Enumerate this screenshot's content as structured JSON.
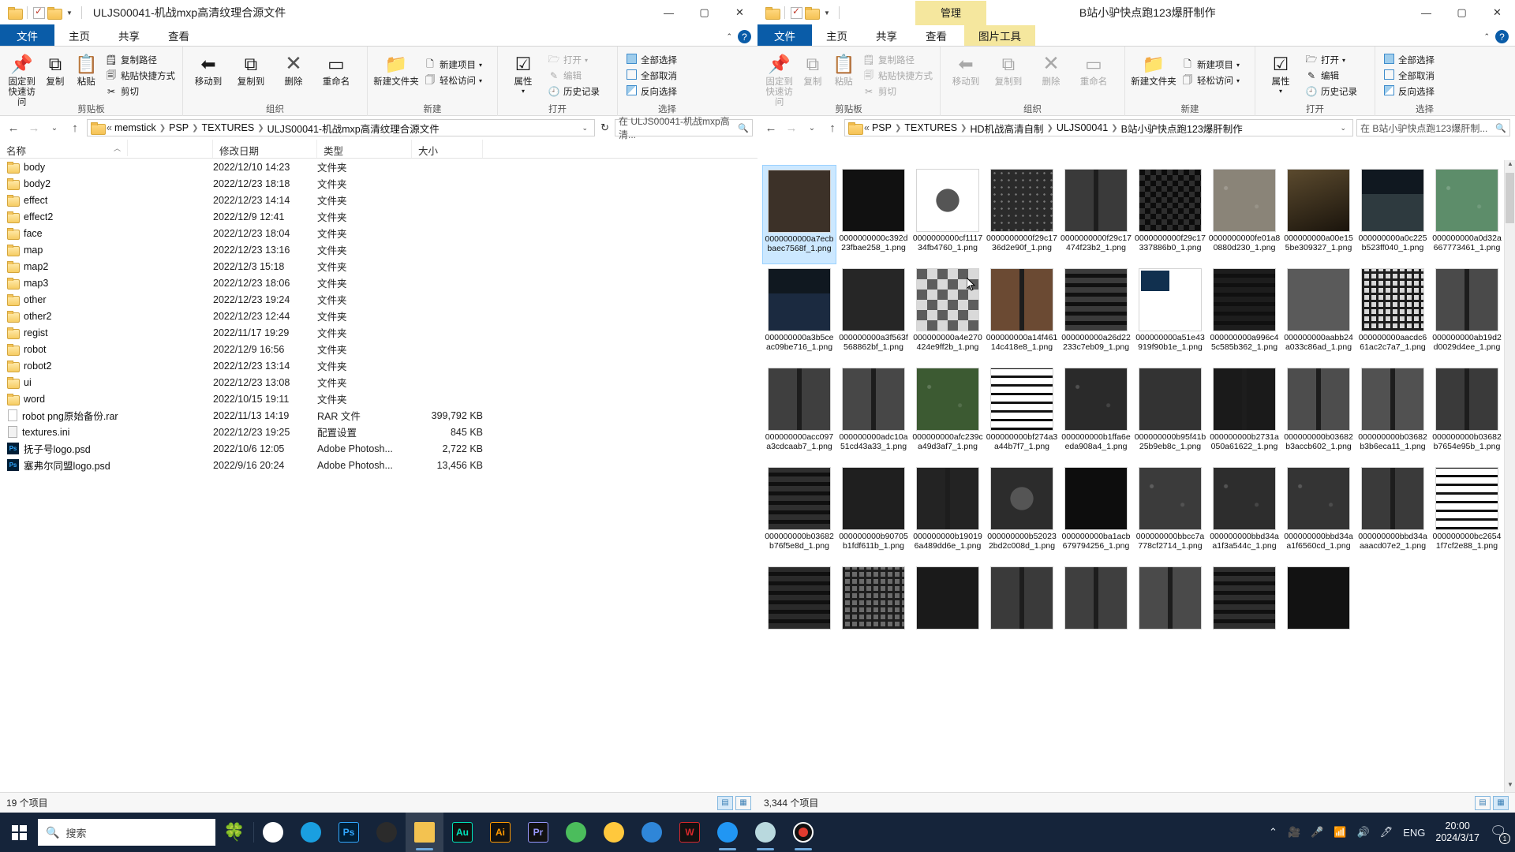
{
  "windows": {
    "left": {
      "title": "ULJS00041-机战mxp高清纹理合源文件",
      "quick_access": {
        "prop_icon": "checklist-icon",
        "folder_icon": "folder-icon",
        "caret": "▾"
      },
      "controls": {
        "minimize": "—",
        "maximize": "▢",
        "close": "✕"
      },
      "tabs": [
        {
          "label": "文件",
          "name": "tab-file"
        },
        {
          "label": "主页",
          "name": "tab-home"
        },
        {
          "label": "共享",
          "name": "tab-share"
        },
        {
          "label": "查看",
          "name": "tab-view"
        }
      ],
      "help_label": "?",
      "ribbon": {
        "groups": [
          {
            "name": "剪贴板",
            "big": [
              {
                "label": "固定到快速访问",
                "icon": "pin-icon"
              },
              {
                "label": "复制",
                "icon": "copy-icon"
              },
              {
                "label": "粘贴",
                "icon": "paste-icon"
              }
            ],
            "small": [
              {
                "label": "复制路径",
                "icon": "copy-path-icon",
                "disabled": false
              },
              {
                "label": "粘贴快捷方式",
                "icon": "paste-shortcut-icon",
                "disabled": false
              },
              {
                "label": "剪切",
                "icon": "scissors-icon",
                "disabled": false
              }
            ]
          },
          {
            "name": "组织",
            "big": [
              {
                "label": "移动到",
                "icon": "move-to-icon"
              },
              {
                "label": "复制到",
                "icon": "copy-to-icon"
              },
              {
                "label": "删除",
                "icon": "delete-x-icon"
              },
              {
                "label": "重命名",
                "icon": "rename-icon"
              }
            ],
            "small": []
          },
          {
            "name": "新建",
            "big": [
              {
                "label": "新建文件夹",
                "icon": "new-folder-icon"
              }
            ],
            "small": [
              {
                "label": "新建项目",
                "icon": "new-item-icon"
              },
              {
                "label": "轻松访问",
                "icon": "easy-access-icon"
              }
            ]
          },
          {
            "name": "打开",
            "big": [
              {
                "label": "属性",
                "icon": "properties-icon"
              }
            ],
            "small": [
              {
                "label": "打开",
                "icon": "open-icon",
                "disabled": true
              },
              {
                "label": "编辑",
                "icon": "edit-icon",
                "disabled": true
              },
              {
                "label": "历史记录",
                "icon": "history-icon",
                "disabled": false
              }
            ]
          },
          {
            "name": "选择",
            "big": [],
            "small": [
              {
                "label": "全部选择",
                "icon": "select-all-icon"
              },
              {
                "label": "全部取消",
                "icon": "select-none-icon"
              },
              {
                "label": "反向选择",
                "icon": "invert-selection-icon"
              }
            ]
          }
        ]
      },
      "address": {
        "back": "←",
        "forward": "→",
        "recent": "⌄",
        "up": "↑",
        "crumbs": [
          "memstick",
          "PSP",
          "TEXTURES",
          "ULJS00041-机战mxp高清纹理合源文件"
        ],
        "prefix": "«",
        "dropdown": "⌄",
        "refresh": "↻",
        "search_value": "在 ULJS00041-机战mxp高清...",
        "search_icon": "search-icon"
      },
      "columns": [
        {
          "label": "名称",
          "name": "column-name"
        },
        {
          "label": "修改日期",
          "name": "column-date"
        },
        {
          "label": "类型",
          "name": "column-type"
        },
        {
          "label": "大小",
          "name": "column-size"
        }
      ],
      "rows": [
        {
          "name": "body",
          "date": "2022/12/10 14:23",
          "type": "文件夹",
          "size": "",
          "icon": "folder"
        },
        {
          "name": "body2",
          "date": "2022/12/23 18:18",
          "type": "文件夹",
          "size": "",
          "icon": "folder"
        },
        {
          "name": "effect",
          "date": "2022/12/23 14:14",
          "type": "文件夹",
          "size": "",
          "icon": "folder"
        },
        {
          "name": "effect2",
          "date": "2022/12/9 12:41",
          "type": "文件夹",
          "size": "",
          "icon": "folder"
        },
        {
          "name": "face",
          "date": "2022/12/23 18:04",
          "type": "文件夹",
          "size": "",
          "icon": "folder"
        },
        {
          "name": "map",
          "date": "2022/12/23 13:16",
          "type": "文件夹",
          "size": "",
          "icon": "folder"
        },
        {
          "name": "map2",
          "date": "2022/12/3 15:18",
          "type": "文件夹",
          "size": "",
          "icon": "folder"
        },
        {
          "name": "map3",
          "date": "2022/12/23 18:06",
          "type": "文件夹",
          "size": "",
          "icon": "folder"
        },
        {
          "name": "other",
          "date": "2022/12/23 19:24",
          "type": "文件夹",
          "size": "",
          "icon": "folder"
        },
        {
          "name": "other2",
          "date": "2022/12/23 12:44",
          "type": "文件夹",
          "size": "",
          "icon": "folder"
        },
        {
          "name": "regist",
          "date": "2022/11/17 19:29",
          "type": "文件夹",
          "size": "",
          "icon": "folder"
        },
        {
          "name": "robot",
          "date": "2022/12/9 16:56",
          "type": "文件夹",
          "size": "",
          "icon": "folder"
        },
        {
          "name": "robot2",
          "date": "2022/12/23 13:14",
          "type": "文件夹",
          "size": "",
          "icon": "folder"
        },
        {
          "name": "ui",
          "date": "2022/12/23 13:08",
          "type": "文件夹",
          "size": "",
          "icon": "folder"
        },
        {
          "name": "word",
          "date": "2022/10/15 19:11",
          "type": "文件夹",
          "size": "",
          "icon": "folder"
        },
        {
          "name": "robot png原始备份.rar",
          "date": "2022/11/13 14:19",
          "type": "RAR 文件",
          "size": "399,792 KB",
          "icon": "doc"
        },
        {
          "name": "textures.ini",
          "date": "2022/12/23 19:25",
          "type": "配置设置",
          "size": "845 KB",
          "icon": "ini"
        },
        {
          "name": "抚子号logo.psd",
          "date": "2022/10/6 12:05",
          "type": "Adobe Photosh...",
          "size": "2,722 KB",
          "icon": "psd"
        },
        {
          "name": "塞弗尔同盟logo.psd",
          "date": "2022/9/16 20:24",
          "type": "Adobe Photosh...",
          "size": "13,456 KB",
          "icon": "psd"
        }
      ],
      "status": {
        "count": "19 个项目",
        "view_details": "details-view-icon",
        "view_large": "large-icons-view-icon"
      }
    },
    "right": {
      "title": "B站小驴快点跑123爆肝制作",
      "context_tab_group": "管理",
      "controls": {
        "minimize": "—",
        "maximize": "▢",
        "close": "✕"
      },
      "tabs": [
        {
          "label": "文件",
          "name": "tab-file"
        },
        {
          "label": "主页",
          "name": "tab-home"
        },
        {
          "label": "共享",
          "name": "tab-share"
        },
        {
          "label": "查看",
          "name": "tab-view"
        },
        {
          "label": "图片工具",
          "name": "tab-picture-tools"
        }
      ],
      "help_label": "?",
      "address": {
        "back": "←",
        "forward": "→",
        "recent": "⌄",
        "up": "↑",
        "prefix": "«",
        "crumbs": [
          "PSP",
          "TEXTURES",
          "HD机战高清自制",
          "ULJS00041",
          "B站小驴快点跑123爆肝制作"
        ],
        "dropdown": "⌄",
        "search_value": "在 B站小驴快点跑123爆肝制...",
        "search_icon": "search-icon"
      },
      "status": {
        "count": "3,344 个项目"
      },
      "thumbnails": [
        {
          "caption": "0000000000a7ecbbaec7568f_1.png",
          "selected": true,
          "color": "#3c3128",
          "pattern": "dark"
        },
        {
          "caption": "0000000000c392d23fbae258_1.png",
          "selected": false,
          "color": "#111111",
          "pattern": "flat"
        },
        {
          "caption": "0000000000cf111734fb4760_1.png",
          "selected": false,
          "color": "#ffffff",
          "pattern": "object"
        },
        {
          "caption": "0000000000f29c1736d2e90f_1.png",
          "selected": false,
          "color": "#2b2b2b",
          "pattern": "dots"
        },
        {
          "caption": "0000000000f29c17474f23b2_1.png",
          "selected": false,
          "color": "#3a3a3a",
          "pattern": "panel"
        },
        {
          "caption": "0000000000f29c17337886b0_1.png",
          "selected": false,
          "color": "#1c1c1c",
          "pattern": "checker"
        },
        {
          "caption": "0000000000fe01a80880d230_1.png",
          "selected": false,
          "color": "#8a8478",
          "pattern": "noise"
        },
        {
          "caption": "000000000a00e155be309327_1.png",
          "selected": false,
          "color": "#5b4a2e",
          "pattern": "grad"
        },
        {
          "caption": "000000000a0c225b523ff040_1.png",
          "selected": false,
          "color": "#2e3a3f",
          "pattern": "scene"
        },
        {
          "caption": "000000000a0d32a667773461_1.png",
          "selected": false,
          "color": "#5d8d6a",
          "pattern": "noise"
        },
        {
          "caption": "000000000a3b5ceac09be716_1.png",
          "selected": false,
          "color": "#1b2a40",
          "pattern": "scene"
        },
        {
          "caption": "000000000a3f563f568862bf_1.png",
          "selected": false,
          "color": "#262626",
          "pattern": "flat"
        },
        {
          "caption": "000000000a4e270424e9ff2b_1.png",
          "selected": false,
          "color": "#9a9a9a",
          "pattern": "blocks"
        },
        {
          "caption": "000000000a14f46114c418e8_1.png",
          "selected": false,
          "color": "#6b4a33",
          "pattern": "panel"
        },
        {
          "caption": "000000000a26d22233c7eb09_1.png",
          "selected": false,
          "color": "#3b3b3b",
          "pattern": "stripes"
        },
        {
          "caption": "000000000a51e43919f90b1e_1.png",
          "selected": false,
          "color": "#ffffff",
          "pattern": "small"
        },
        {
          "caption": "000000000a996c45c585b362_1.png",
          "selected": false,
          "color": "#1d1d1d",
          "pattern": "stripes"
        },
        {
          "caption": "000000000aabb24a033c86ad_1.png",
          "selected": false,
          "color": "#5a5a5a",
          "pattern": "flat"
        },
        {
          "caption": "000000000aacdc661ac2c7a7_1.png",
          "selected": false,
          "color": "#d8d8d8",
          "pattern": "grid"
        },
        {
          "caption": "000000000ab19d2d0029d4ee_1.png",
          "selected": false,
          "color": "#4a4a4a",
          "pattern": "panel"
        },
        {
          "caption": "000000000acc097a3cdcaab7_1.png",
          "selected": false,
          "color": "#3f3f3f",
          "pattern": "panel"
        },
        {
          "caption": "000000000adc10a51cd43a33_1.png",
          "selected": false,
          "color": "#474747",
          "pattern": "panel"
        },
        {
          "caption": "000000000afc239ca49d3af7_1.png",
          "selected": false,
          "color": "#3c5a32",
          "pattern": "noise"
        },
        {
          "caption": "000000000bf274a3a44b7f7_1.png",
          "selected": false,
          "color": "#ffffff",
          "pattern": "glyphs"
        },
        {
          "caption": "000000000b1ffa6eeda908a4_1.png",
          "selected": false,
          "color": "#2a2a2a",
          "pattern": "noise"
        },
        {
          "caption": "000000000b95f41b25b9eb8c_1.png",
          "selected": false,
          "color": "#333333",
          "pattern": "flat"
        },
        {
          "caption": "000000000b2731a050a61622_1.png",
          "selected": false,
          "color": "#1a1a1a",
          "pattern": "panel"
        },
        {
          "caption": "000000000b03682b3accb602_1.png",
          "selected": false,
          "color": "#4d4d4d",
          "pattern": "panel"
        },
        {
          "caption": "000000000b03682b3b6eca11_1.png",
          "selected": false,
          "color": "#515151",
          "pattern": "panel"
        },
        {
          "caption": "000000000b03682b7654e95b_1.png",
          "selected": false,
          "color": "#3a3a3a",
          "pattern": "panel"
        },
        {
          "caption": "000000000b03682b76f5e8d_1.png",
          "selected": false,
          "color": "#2f2f2f",
          "pattern": "stripes"
        },
        {
          "caption": "000000000b90705b1fdf611b_1.png",
          "selected": false,
          "color": "#1f1f1f",
          "pattern": "flat"
        },
        {
          "caption": "000000000b190196a489dd6e_1.png",
          "selected": false,
          "color": "#232323",
          "pattern": "panel"
        },
        {
          "caption": "000000000b520232bd2c008d_1.png",
          "selected": false,
          "color": "#2c2c2c",
          "pattern": "object"
        },
        {
          "caption": "000000000ba1acb679794256_1.png",
          "selected": false,
          "color": "#0d0d0d",
          "pattern": "flat"
        },
        {
          "caption": "000000000bbcc7a778cf2714_1.png",
          "selected": false,
          "color": "#3b3b3b",
          "pattern": "noise"
        },
        {
          "caption": "000000000bbd34aa1f3a544c_1.png",
          "selected": false,
          "color": "#2d2d2d",
          "pattern": "noise"
        },
        {
          "caption": "000000000bbd34aa1f6560cd_1.png",
          "selected": false,
          "color": "#343434",
          "pattern": "noise"
        },
        {
          "caption": "000000000bbd34aaaacd07e2_1.png",
          "selected": false,
          "color": "#3a3a3a",
          "pattern": "panel"
        },
        {
          "caption": "000000000bc26541f7cf2e88_1.png",
          "selected": false,
          "color": "#ffffff",
          "pattern": "glyphs"
        },
        {
          "caption": "",
          "selected": false,
          "color": "#2a2a2a",
          "pattern": "stripes"
        },
        {
          "caption": "",
          "selected": false,
          "color": "#6a6a6a",
          "pattern": "grid"
        },
        {
          "caption": "",
          "selected": false,
          "color": "#1a1a1a",
          "pattern": "flat"
        },
        {
          "caption": "",
          "selected": false,
          "color": "#3a3a3a",
          "pattern": "panel"
        },
        {
          "caption": "",
          "selected": false,
          "color": "#3f3f3f",
          "pattern": "panel"
        },
        {
          "caption": "",
          "selected": false,
          "color": "#4a4a4a",
          "pattern": "panel"
        },
        {
          "caption": "",
          "selected": false,
          "color": "#2e2e2e",
          "pattern": "stripes"
        },
        {
          "caption": "",
          "selected": false,
          "color": "#121212",
          "pattern": "flat"
        }
      ]
    }
  },
  "taskbar": {
    "start_icon": "windows-start-icon",
    "search": {
      "placeholder": "搜索",
      "icon": "search-icon"
    },
    "items": [
      {
        "name": "taskview-button",
        "icon": "task-view-icon",
        "label": "",
        "color": "#ffffff",
        "running": false
      },
      {
        "name": "taskbar-edge",
        "icon": "edge-icon",
        "label": "",
        "color": "#1a9fe0",
        "running": false
      },
      {
        "name": "taskbar-photoshop",
        "icon": "photoshop-icon",
        "label": "Ps",
        "color": "#001e36",
        "running": false
      },
      {
        "name": "taskbar-app-dark",
        "icon": "app-icon",
        "label": "",
        "color": "#2b2b2b",
        "running": false
      },
      {
        "name": "taskbar-file-explorer",
        "icon": "file-explorer-icon",
        "label": "",
        "color": "#f3c250",
        "running": true
      },
      {
        "name": "taskbar-audition",
        "icon": "audition-icon",
        "label": "Au",
        "color": "#00e4bb",
        "running": false
      },
      {
        "name": "taskbar-illustrator",
        "icon": "illustrator-icon",
        "label": "Ai",
        "color": "#ff9a00",
        "running": false
      },
      {
        "name": "taskbar-premiere",
        "icon": "premiere-icon",
        "label": "Pr",
        "color": "#9999ff",
        "running": false
      },
      {
        "name": "taskbar-wechat",
        "icon": "wechat-icon",
        "label": "",
        "color": "#4bbd5c",
        "running": false
      },
      {
        "name": "taskbar-app-yellow",
        "icon": "app-icon",
        "label": "",
        "color": "#ffc83d",
        "running": false
      },
      {
        "name": "taskbar-browser-blue",
        "icon": "browser-icon",
        "label": "",
        "color": "#2f86d8",
        "running": false
      },
      {
        "name": "taskbar-wps",
        "icon": "wps-icon",
        "label": "W",
        "color": "#d7272b",
        "running": false
      },
      {
        "name": "taskbar-app-bird",
        "icon": "app-icon",
        "label": "",
        "color": "#2196f3",
        "running": true
      },
      {
        "name": "taskbar-app-paper",
        "icon": "app-icon",
        "label": "",
        "color": "#b9d9de",
        "running": true
      },
      {
        "name": "taskbar-recorder",
        "icon": "record-icon",
        "label": "",
        "color": "#e23b2e",
        "running": true
      }
    ],
    "tray": {
      "chevron": "chevron-up-icon",
      "camera": "camera-icon",
      "mic": "microphone-icon",
      "wifi": "wifi-icon",
      "volume": "volume-icon",
      "pen": "pen-icon",
      "language": "ENG",
      "time": "20:00",
      "date": "2024/3/17",
      "notification_icon": "notification-icon",
      "notification_count": "1"
    }
  }
}
